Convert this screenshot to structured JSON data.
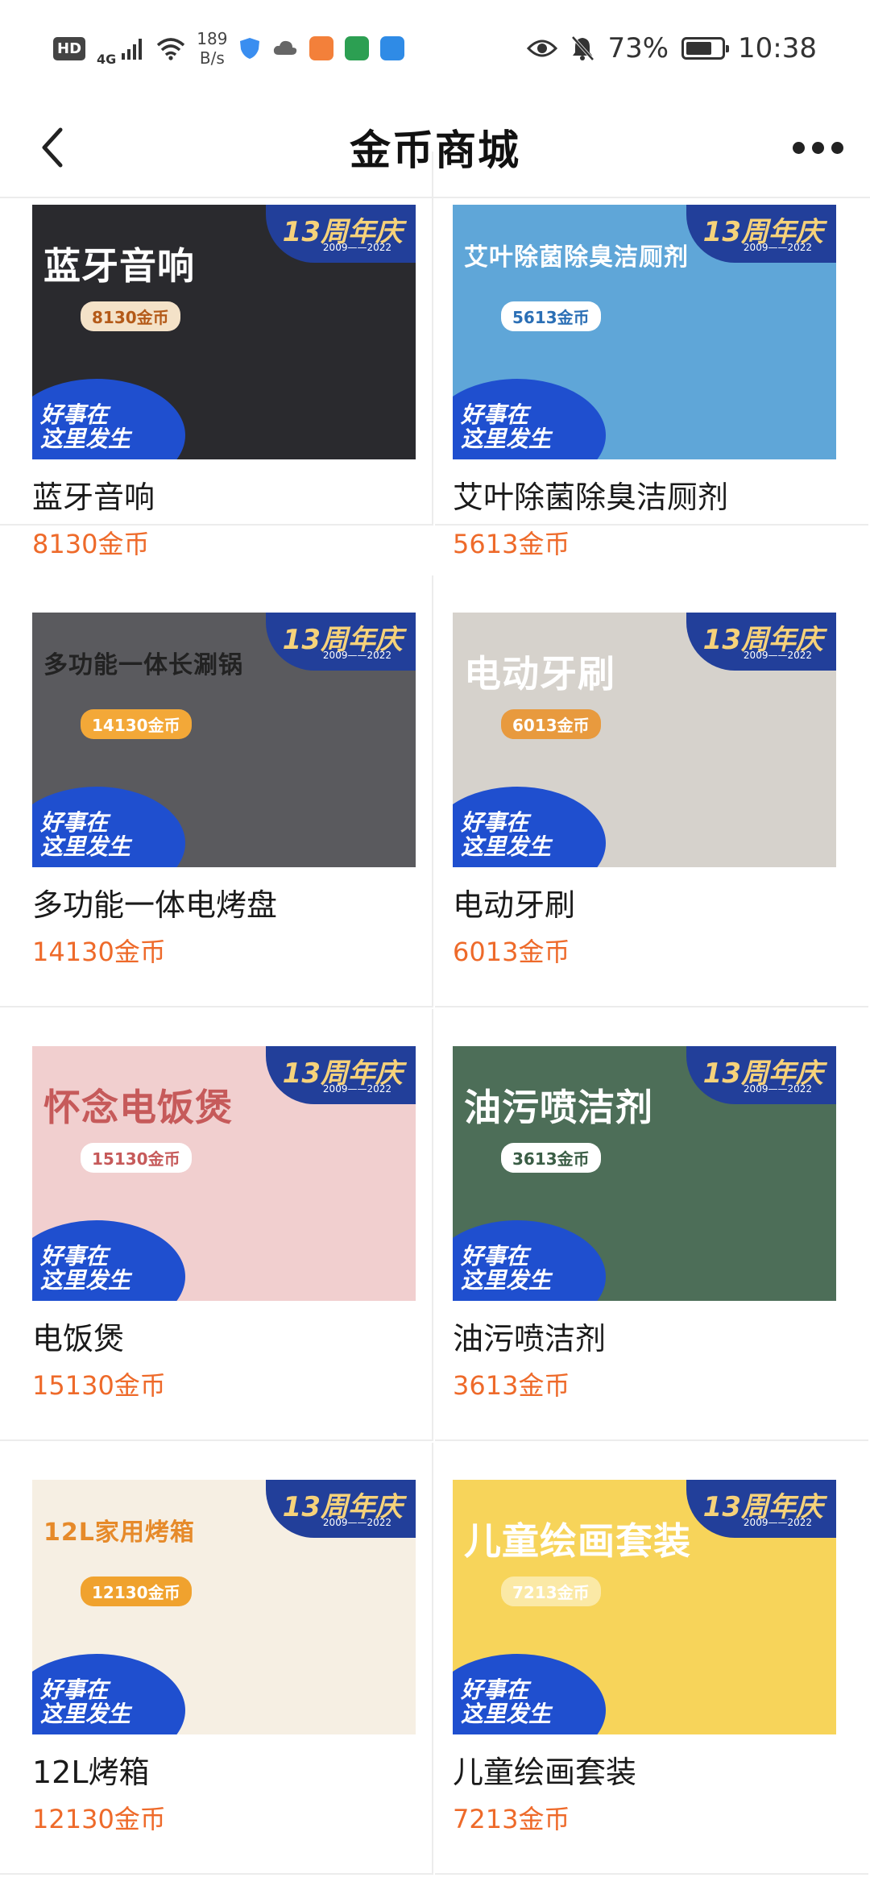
{
  "status_bar": {
    "hd": "HD",
    "network": "4G",
    "speed_value": "189",
    "speed_unit": "B/s",
    "battery": "73%",
    "battery_level": 0.73,
    "time": "10:38",
    "icons": [
      "hd-badge-icon",
      "signal-icon",
      "wifi-icon",
      "shield-icon",
      "cloud-icon",
      "app-icon",
      "app-icon",
      "app-icon",
      "eye-icon",
      "bell-off-icon",
      "battery-icon"
    ]
  },
  "nav": {
    "title": "金币商城",
    "back_icon": "chevron-left-icon",
    "more_icon": "more-icon"
  },
  "thumb_common": {
    "anniversary": "13周年庆",
    "years": "2009——2022",
    "slogan": "好事在\n这里发生"
  },
  "products": [
    {
      "name": "蓝牙音响",
      "price": "8130金币",
      "headline": "蓝牙音响",
      "tag": "8130金币",
      "bg": "#2a2a2e",
      "headline_color": "#ffffff",
      "tag_bg": "#f4e2c8",
      "tag_color": "#b45a18"
    },
    {
      "name": "艾叶除菌除臭洁厕剂",
      "price": "5613金币",
      "headline": "艾叶除菌除臭洁厕剂",
      "tag": "5613金币",
      "bg": "#5fa6d8",
      "headline_color": "#ffffff",
      "tag_bg": "#ffffff",
      "tag_color": "#2b6fb5"
    },
    {
      "name": "多功能一体电烤盘",
      "price": "14130金币",
      "headline": "多功能一体长涮锅",
      "tag": "14130金币",
      "bg": "#5a5a5e",
      "headline_color": "#222222",
      "tag_bg": "#f3a838",
      "tag_color": "#ffffff"
    },
    {
      "name": "电动牙刷",
      "price": "6013金币",
      "headline": "电动牙刷",
      "tag": "6013金币",
      "bg": "#d6d2cc",
      "headline_color": "#ffffff",
      "tag_bg": "#e89a3e",
      "tag_color": "#ffffff"
    },
    {
      "name": "电饭煲",
      "price": "15130金币",
      "headline": "怀念电饭煲",
      "tag": "15130金币",
      "bg": "#f1cfcf",
      "headline_color": "#c65a5a",
      "tag_bg": "#ffffff",
      "tag_color": "#c65a5a"
    },
    {
      "name": "油污喷洁剂",
      "price": "3613金币",
      "headline": "油污喷洁剂",
      "tag": "3613金币",
      "bg": "#4d6e58",
      "headline_color": "#ffffff",
      "tag_bg": "#ffffff",
      "tag_color": "#3a5d45"
    },
    {
      "name": "12L烤箱",
      "price": "12130金币",
      "headline": "12L家用烤箱",
      "tag": "12130金币",
      "bg": "#f6efe3",
      "headline_color": "#e68a2a",
      "tag_bg": "#f0a22e",
      "tag_color": "#ffffff"
    },
    {
      "name": "儿童绘画套装",
      "price": "7213金币",
      "headline": "儿童绘画套装",
      "tag": "7213金币",
      "bg": "#f7d45a",
      "headline_color": "#ffffff",
      "tag_bg": "#fbe9a6",
      "tag_color": "#ffffff"
    }
  ],
  "colors": {
    "price": "#ee6a2a",
    "divider": "#ececec",
    "anniversary_bg": "#223f9a",
    "slogan_bg": "#1f4fcf"
  }
}
